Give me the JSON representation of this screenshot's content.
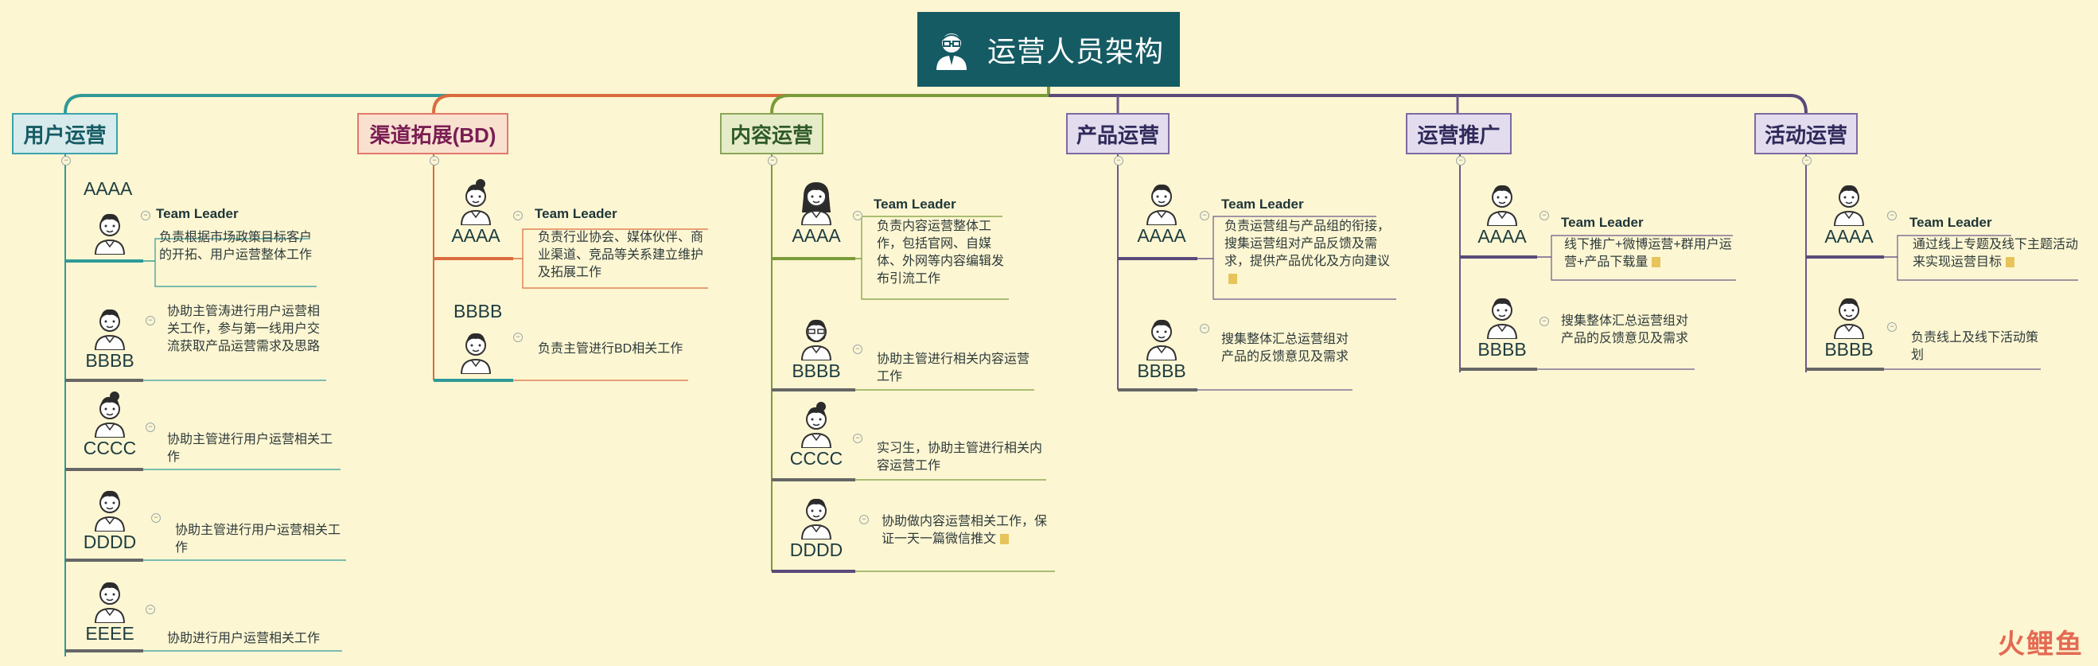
{
  "root": {
    "title": "运营人员架构"
  },
  "team_leader_label": "Team Leader",
  "branches": [
    {
      "label": "用户运营",
      "border": "#3aa3ad",
      "bg": "#d7eaec",
      "text": "#155b64",
      "line": "#2f9a98",
      "members": [
        {
          "name": "AAAA",
          "role": "Team Leader",
          "desc": "负责根据市场政策目标客户的开拓、用户运营整体工作"
        },
        {
          "name": "BBBB",
          "desc": "协助主管涛进行用户运营相关工作，参与第一线用户交流获取产品运营需求及思路"
        },
        {
          "name": "CCCC",
          "desc": "协助主管进行用户运营相关工作"
        },
        {
          "name": "DDDD",
          "desc": "协助主管进行用户运营相关工作"
        },
        {
          "name": "EEEE",
          "desc": "协助进行用户运营相关工作"
        }
      ]
    },
    {
      "label": "渠道拓展(BD)",
      "border": "#e2796b",
      "bg": "#f9e1cf",
      "text": "#7a1d54",
      "line": "#d96c3e",
      "members": [
        {
          "name": "AAAA",
          "role": "Team Leader",
          "desc": "负责行业协会、媒体伙伴、商业渠道、竞品等关系建立维护及拓展工作"
        },
        {
          "name": "BBBB",
          "desc": "负责主管进行BD相关工作"
        }
      ]
    },
    {
      "label": "内容运营",
      "border": "#8aa65a",
      "bg": "#e7ecc8",
      "text": "#2f5a2a",
      "line": "#7a9b3a",
      "members": [
        {
          "name": "AAAA",
          "role": "Team Leader",
          "desc": "负责内容运营整体工作，包括官网、自媒体、外网等内容编辑发布引流工作"
        },
        {
          "name": "BBBB",
          "desc": "协助主管进行相关内容运营工作"
        },
        {
          "name": "CCCC",
          "desc": "实习生，协助主管进行相关内容运营工作"
        },
        {
          "name": "DDDD",
          "desc": "协助做内容运营相关工作，保证一天一篇微信推文",
          "note": true
        }
      ]
    },
    {
      "label": "产品运营",
      "border": "#7d6aa3",
      "bg": "#e3dcee",
      "text": "#2f2a5a",
      "line": "#6a5a8a",
      "members": [
        {
          "name": "AAAA",
          "role": "Team Leader",
          "desc": "负责运营组与产品组的衔接，搜集运营组对产品反馈及需求，提供产品优化及方向建议",
          "note": true
        },
        {
          "name": "BBBB",
          "desc": "搜集整体汇总运营组对产品的反馈意见及需求"
        }
      ]
    },
    {
      "label": "运营推广",
      "border": "#7d6aa3",
      "bg": "#e3dcee",
      "text": "#2f2a5a",
      "line": "#6a5a8a",
      "members": [
        {
          "name": "AAAA",
          "role": "Team Leader",
          "desc": "线下推广+微博运营+群用户运营+产品下载量",
          "note": true
        },
        {
          "name": "BBBB",
          "desc": "搜集整体汇总运营组对产品的反馈意见及需求"
        }
      ]
    },
    {
      "label": "活动运营",
      "border": "#7d6aa3",
      "bg": "#e3dcee",
      "text": "#2f2a5a",
      "line": "#6a5a8a",
      "members": [
        {
          "name": "AAAA",
          "role": "Team Leader",
          "desc": "通过线上专题及线下主题活动来实现运营目标",
          "note": true
        },
        {
          "name": "BBBB",
          "desc": "负责线上及线下活动策划"
        }
      ]
    }
  ],
  "watermark": "火鲤鱼"
}
